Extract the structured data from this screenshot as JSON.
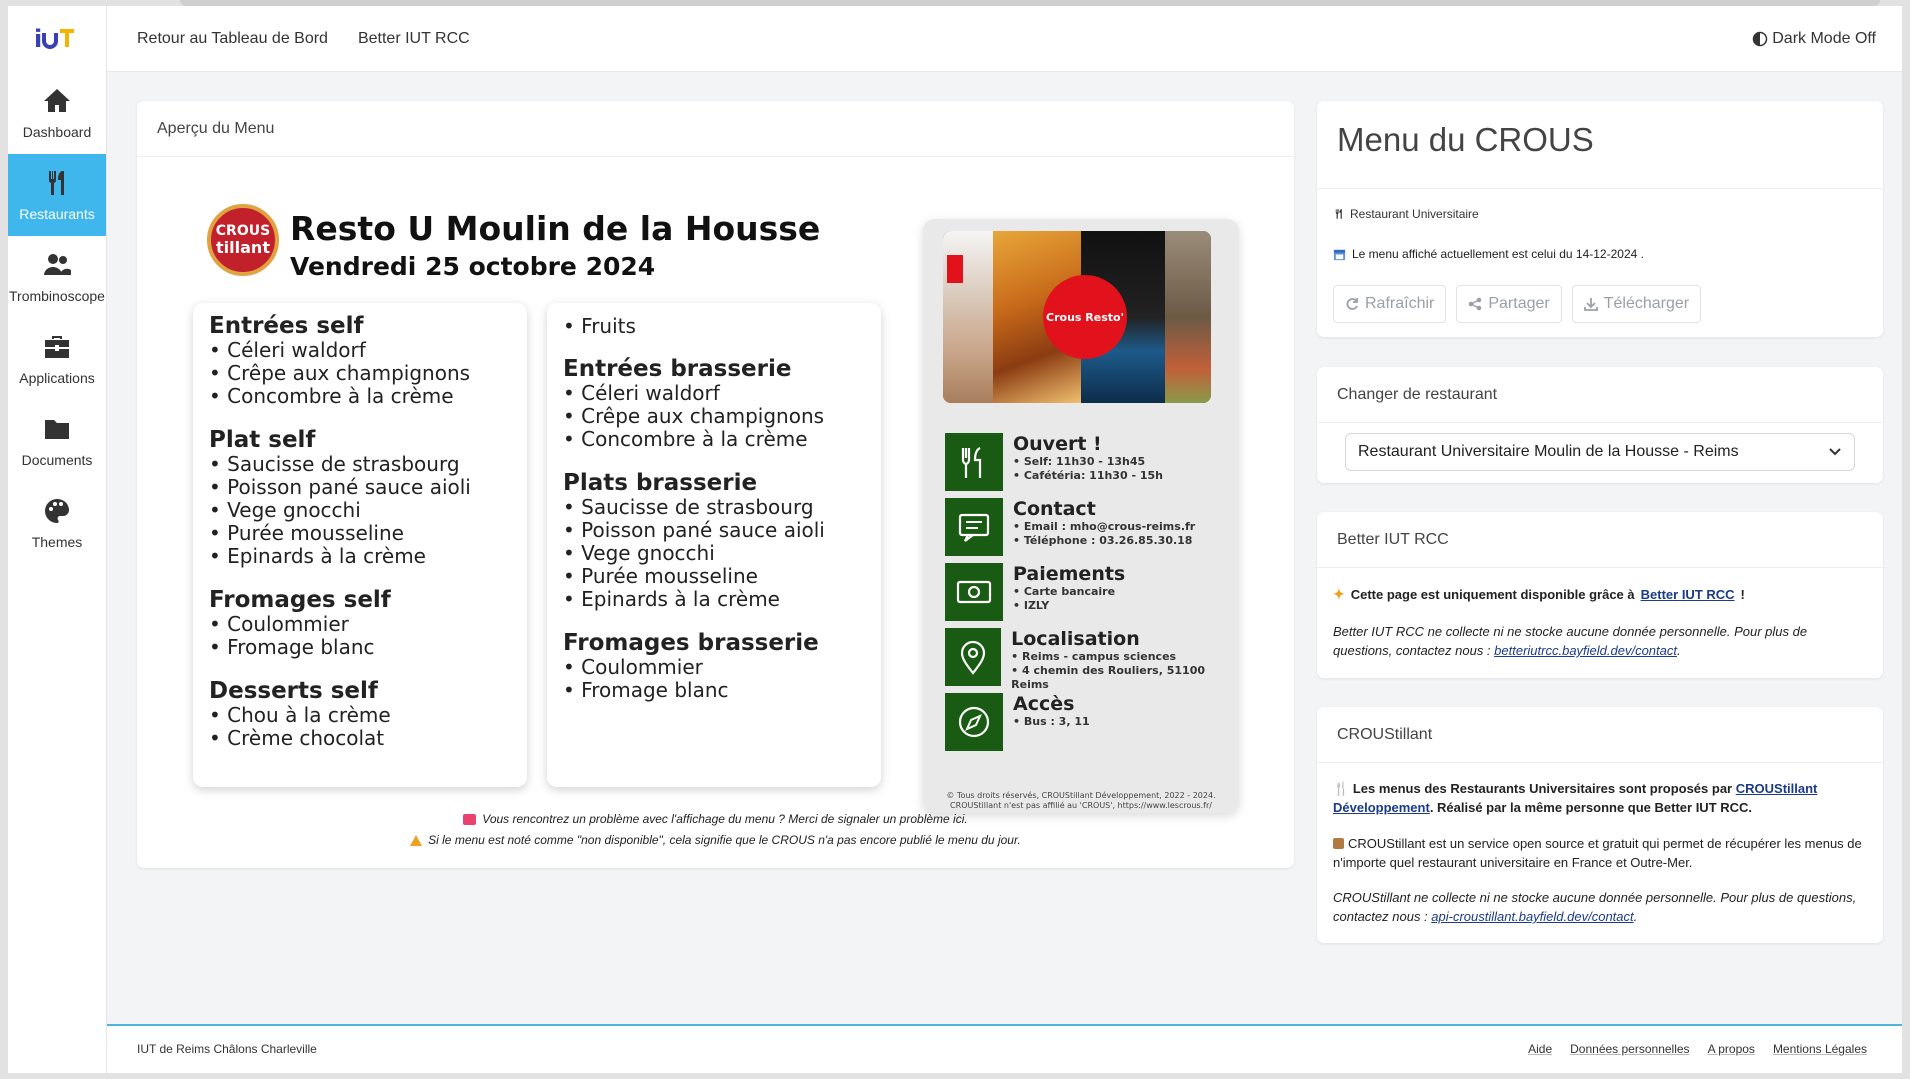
{
  "app": {
    "logo_text": "IUT"
  },
  "sidebar": {
    "items": [
      {
        "label": "Dashboard",
        "icon": "home-icon"
      },
      {
        "label": "Restaurants",
        "icon": "utensils-icon",
        "active": true
      },
      {
        "label": "Trombinoscope",
        "icon": "users-icon"
      },
      {
        "label": "Applications",
        "icon": "toolbox-icon"
      },
      {
        "label": "Documents",
        "icon": "folder-icon"
      },
      {
        "label": "Themes",
        "icon": "palette-icon"
      }
    ]
  },
  "topbar": {
    "links": [
      "Retour au Tableau de Bord",
      "Better IUT RCC"
    ],
    "dark_mode": "Dark Mode Off"
  },
  "preview": {
    "header": "Aperçu du Menu",
    "poster": {
      "logo_top": "CROUS",
      "logo_bottom": "tillant",
      "title": "Resto U Moulin de la Housse",
      "date": "Vendredi 25 octobre 2024",
      "col1": [
        {
          "title": "Entrées self",
          "items": [
            "Céleri waldorf",
            "Crêpe aux champignons",
            "Concombre à la crème"
          ]
        },
        {
          "title": "Plat self",
          "items": [
            "Saucisse de strasbourg",
            "Poisson pané sauce aioli",
            "Vege gnocchi",
            "Purée mousseline",
            "Epinards à la crème"
          ]
        },
        {
          "title": "Fromages self",
          "items": [
            "Coulommier",
            "Fromage blanc"
          ]
        },
        {
          "title": "Desserts self",
          "items": [
            "Chou à la crème",
            "Crème chocolat"
          ]
        }
      ],
      "col2_top_item": "Fruits",
      "col2": [
        {
          "title": "Entrées brasserie",
          "items": [
            "Céleri waldorf",
            "Crêpe aux champignons",
            "Concombre à la crème"
          ]
        },
        {
          "title": "Plats brasserie",
          "items": [
            "Saucisse de strasbourg",
            "Poisson pané sauce aioli",
            "Vege gnocchi",
            "Purée mousseline",
            "Epinards à la crème"
          ]
        },
        {
          "title": "Fromages brasserie",
          "items": [
            "Coulommier",
            "Fromage blanc"
          ]
        }
      ],
      "photo_logo": "Crous Resto'",
      "info": [
        {
          "title": "Ouvert !",
          "lines": [
            "• Self: 11h30 - 13h45",
            "• Cafétéria: 11h30 - 15h"
          ],
          "icon": "utensils-icon"
        },
        {
          "title": "Contact",
          "lines": [
            "• Email : mho@crous-reims.fr",
            "• Téléphone : 03.26.85.30.18"
          ],
          "icon": "message-icon"
        },
        {
          "title": "Paiements",
          "lines": [
            "• Carte bancaire",
            "• IZLY"
          ],
          "icon": "money-icon"
        },
        {
          "title": "Localisation",
          "lines": [
            "• Reims - campus sciences",
            "• 4 chemin des Rouliers, 51100 Reims"
          ],
          "icon": "map-pin-icon"
        },
        {
          "title": "Accès",
          "lines": [
            "• Bus : 3, 11"
          ],
          "icon": "compass-icon"
        }
      ],
      "copyright_1": "© Tous droits réservés, CROUStillant Développement, 2022 - 2024.",
      "copyright_2": "CROUStillant n'est pas affilié au 'CROUS', https://www.lescrous.fr/"
    },
    "notice_1": "Vous rencontrez un problème avec l'affichage du menu ? Merci de signaler un problème ici.",
    "notice_2": "Si le menu est noté comme \"non disponible\", cela signifie que le CROUS n'a pas encore publié le menu du jour."
  },
  "crous_card": {
    "title": "Menu du CROUS",
    "type": "Restaurant Universitaire",
    "date_text": "Le menu affiché actuellement est celui du 14-12-2024 .",
    "buttons": [
      "Rafraîchir",
      "Partager",
      "Télécharger"
    ]
  },
  "change_card": {
    "title": "Changer de restaurant",
    "selected": "Restaurant Universitaire Moulin de la Housse - Reims"
  },
  "better_card": {
    "title": "Better IUT RCC",
    "line1_prefix": "Cette page est uniquement disponible grâce à",
    "line1_link": "Better IUT RCC",
    "line1_suffix": "!",
    "privacy_prefix": "Better IUT RCC ne collecte ni ne stocke aucune donnée personnelle. Pour plus de questions, contactez nous :",
    "privacy_link": "betteriutrcc.bayfield.dev/contact",
    "privacy_suffix": "."
  },
  "croustillant_card": {
    "title": "CROUStillant",
    "p1_prefix": "Les menus des Restaurants Universitaires sont proposés par",
    "p1_link": "CROUStillant Développement",
    "p1_suffix": ". Réalisé par la même personne que Better IUT RCC.",
    "p2": "CROUStillant est un service open source et gratuit qui permet de récupérer les menus de n'importe quel restaurant universitaire en France et Outre-Mer.",
    "p3_prefix": "CROUStillant ne collecte ni ne stocke aucune donnée personnelle. Pour plus de questions, contactez nous :",
    "p3_link": "api-croustillant.bayfield.dev/contact",
    "p3_suffix": "."
  },
  "footer": {
    "left": "IUT de Reims Châlons Charleville",
    "links": [
      "Aide",
      "Données personnelles",
      "A propos",
      "Mentions Légales"
    ]
  },
  "colors": {
    "accent": "#3fb6ec",
    "green": "#1a5b13",
    "footer_line": "#4fb3d9"
  }
}
